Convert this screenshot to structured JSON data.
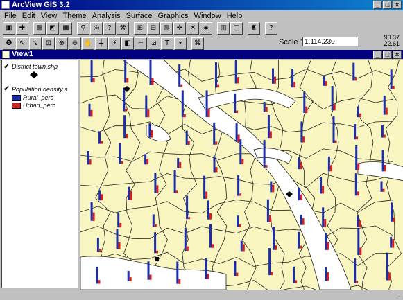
{
  "window": {
    "title": "ArcView GIS 3.2"
  },
  "menu": [
    "File",
    "Edit",
    "View",
    "Theme",
    "Analysis",
    "Surface",
    "Graphics",
    "Window",
    "Help"
  ],
  "toolbar1": [
    {
      "name": "save",
      "glyph": "▣"
    },
    {
      "name": "add-theme",
      "glyph": "✚"
    },
    {
      "name": "theme-props",
      "glyph": "▤"
    },
    {
      "name": "edit-legend",
      "glyph": "◩"
    },
    {
      "name": "open-table",
      "glyph": "▦"
    },
    {
      "name": "find",
      "glyph": "⚲"
    },
    {
      "name": "locate",
      "glyph": "◎"
    },
    {
      "name": "query",
      "glyph": "?"
    },
    {
      "name": "hammer",
      "glyph": "⚒"
    },
    {
      "name": "zoom-full",
      "glyph": "⊞"
    },
    {
      "name": "zoom-active",
      "glyph": "⊟"
    },
    {
      "name": "zoom-selected",
      "glyph": "▧"
    },
    {
      "name": "zoom-in",
      "glyph": "✛"
    },
    {
      "name": "zoom-out",
      "glyph": "✕"
    },
    {
      "name": "zoom-prev",
      "glyph": "◈"
    },
    {
      "name": "select-feature",
      "glyph": "▥"
    },
    {
      "name": "clear-select",
      "glyph": "▢"
    },
    {
      "name": "layout",
      "glyph": "♜"
    },
    {
      "name": "help",
      "glyph": "?"
    }
  ],
  "toolbar2": [
    {
      "name": "identify",
      "glyph": "❶"
    },
    {
      "name": "pointer",
      "glyph": "↖"
    },
    {
      "name": "vertex-edit",
      "glyph": "↘"
    },
    {
      "name": "select-feat",
      "glyph": "⊡"
    },
    {
      "name": "zoom-in-tool",
      "glyph": "⊕"
    },
    {
      "name": "zoom-out-tool",
      "glyph": "⊖"
    },
    {
      "name": "pan",
      "glyph": "✋"
    },
    {
      "name": "measure",
      "glyph": "╪"
    },
    {
      "name": "hotlink",
      "glyph": "⚡"
    },
    {
      "name": "label",
      "glyph": "◧"
    },
    {
      "name": "text-label",
      "glyph": "⌐"
    },
    {
      "name": "area-label",
      "glyph": "⊿"
    },
    {
      "name": "text",
      "glyph": "T"
    },
    {
      "name": "draw-point",
      "glyph": "•"
    },
    {
      "name": "snap",
      "glyph": "⌘"
    }
  ],
  "scale": {
    "label": "Scale 1:",
    "value": "1,114,230"
  },
  "coords": {
    "x": "90.37",
    "y": "22.61"
  },
  "view": {
    "title": "View1"
  },
  "legend": {
    "theme1": {
      "name": "District town.shp",
      "checked": true
    },
    "theme2": {
      "name": "Population density.s",
      "checked": true,
      "items": [
        {
          "label": "Rural_perc",
          "color": "#1c2fa8"
        },
        {
          "label": "Urban_perc",
          "color": "#d42020"
        }
      ]
    }
  },
  "colors": {
    "land": "#f8f5c0",
    "water": "#ffffff",
    "rural": "#1c2fa8",
    "urban": "#d42020"
  }
}
